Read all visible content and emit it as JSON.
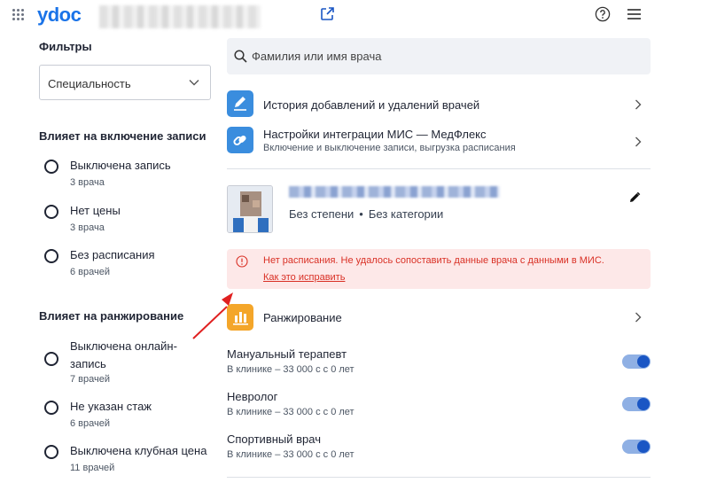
{
  "header": {
    "logo": "ydoc",
    "icons": [
      "apps-grid-icon",
      "external-link-icon",
      "help-icon",
      "menu-icon"
    ]
  },
  "sidebar": {
    "filters_title": "Фильтры",
    "specialty_placeholder": "Специальность",
    "section_booking": {
      "title": "Влияет на включение записи",
      "items": [
        {
          "label": "Выключена запись",
          "count": "3 врача"
        },
        {
          "label": "Нет цены",
          "count": "3 врача"
        },
        {
          "label": "Без расписания",
          "count": "6 врачей"
        }
      ]
    },
    "section_ranking": {
      "title": "Влияет на ранжирование",
      "items": [
        {
          "label": "Выключена онлайн-запись",
          "count": "7 врачей"
        },
        {
          "label": "Не указан стаж",
          "count": "6 врачей"
        },
        {
          "label": "Выключена клубная цена",
          "count": "11 врачей"
        }
      ]
    }
  },
  "main": {
    "search_placeholder": "Фамилия или имя врача",
    "history_link": {
      "title": "История добавлений и удалений врачей"
    },
    "integration_link": {
      "title": "Настройки интеграции МИС — МедФлекс",
      "subtitle": "Включение и выключение записи, выгрузка расписания"
    },
    "doctor": {
      "degree": "Без степени",
      "category": "Без категории",
      "separator": "•"
    },
    "alert": {
      "text": "Нет расписания. Не удалось сопоставить данные врача с данными в МИС.",
      "link": "Как это исправить"
    },
    "ranking": {
      "title": "Ранжирование"
    },
    "specialties": [
      {
        "name": "Мануальный терапевт",
        "price": "В клинике – 33 000 с с 0 лет",
        "enabled": true
      },
      {
        "name": "Невролог",
        "price": "В клинике – 33 000 с с 0 лет",
        "enabled": true
      },
      {
        "name": "Спортивный врач",
        "price": "В клинике – 33 000 с с 0 лет",
        "enabled": true
      }
    ]
  },
  "colors": {
    "brand": "#1a73e8",
    "alert_text": "#d93025",
    "alert_bg": "#fde8e8",
    "toggle_on": "#1a56c4",
    "link_icon": "#3a8dde",
    "rank_icon": "#f4a62a",
    "annotation_arrow": "#e02020"
  }
}
